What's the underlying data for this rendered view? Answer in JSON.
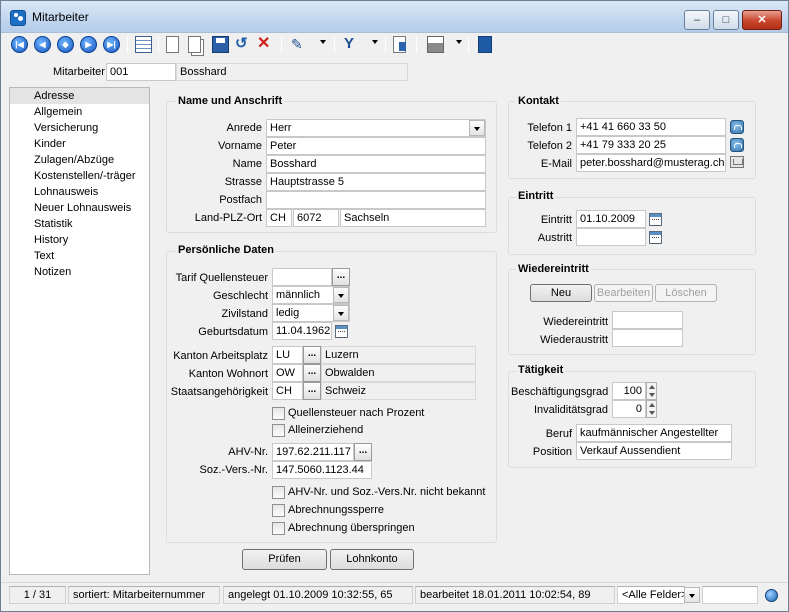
{
  "window": {
    "title": "Mitarbeiter",
    "minimize": "–",
    "maximize": "□",
    "close": "✕"
  },
  "header": {
    "label": "Mitarbeiter",
    "number": "001",
    "name": "Bosshard"
  },
  "sidebar": {
    "items": [
      "Adresse",
      "Allgemein",
      "Versicherung",
      "Kinder",
      "Zulagen/Abzüge",
      "Kostenstellen/-träger",
      "Lohnausweis",
      "Neuer Lohnausweis",
      "Statistik",
      "History",
      "Text",
      "Notizen"
    ]
  },
  "name_address": {
    "title": "Name und Anschrift",
    "anrede": {
      "label": "Anrede",
      "value": "Herr"
    },
    "vorname": {
      "label": "Vorname",
      "value": "Peter"
    },
    "name": {
      "label": "Name",
      "value": "Bosshard"
    },
    "strasse": {
      "label": "Strasse",
      "value": "Hauptstrasse 5"
    },
    "postfach": {
      "label": "Postfach",
      "value": ""
    },
    "land_plz_ort": {
      "label": "Land-PLZ-Ort",
      "land": "CH",
      "plz": "6072",
      "ort": "Sachseln"
    }
  },
  "personal": {
    "title": "Persönliche Daten",
    "tarif": {
      "label": "Tarif Quellensteuer",
      "value": ""
    },
    "geschlecht": {
      "label": "Geschlecht",
      "value": "männlich"
    },
    "zivilstand": {
      "label": "Zivilstand",
      "value": "ledig"
    },
    "geburtsdatum": {
      "label": "Geburtsdatum",
      "value": "11.04.1962"
    },
    "kanton_arbeitsplatz": {
      "label": "Kanton Arbeitsplatz",
      "code": "LU",
      "name": "Luzern"
    },
    "kanton_wohnort": {
      "label": "Kanton Wohnort",
      "code": "OW",
      "name": "Obwalden"
    },
    "staat": {
      "label": "Staatsangehörigkeit",
      "code": "CH",
      "name": "Schweiz"
    },
    "check_quellensteuer": "Quellensteuer nach Prozent",
    "check_alleinerziehend": "Alleinerziehend",
    "ahv": {
      "label": "AHV-Nr.",
      "value": "197.62.211.117"
    },
    "sozvers": {
      "label": "Soz.-Vers.-Nr.",
      "value": "147.5060.1123.44"
    },
    "check_unbekannt": "AHV-Nr. und Soz.-Vers.Nr. nicht bekannt",
    "check_sperre": "Abrechnungssperre",
    "check_ueberspringen": "Abrechnung überspringen"
  },
  "buttons": {
    "pruefen": "Prüfen",
    "lohnkonto": "Lohnkonto"
  },
  "contact": {
    "title": "Kontakt",
    "tel1": {
      "label": "Telefon 1",
      "value": "+41 41 660 33 50"
    },
    "tel2": {
      "label": "Telefon 2",
      "value": "+41 79 333 20 25"
    },
    "email": {
      "label": "E-Mail",
      "value": "peter.bosshard@musterag.ch"
    }
  },
  "entry": {
    "title": "Eintritt",
    "eintritt": {
      "label": "Eintritt",
      "value": "01.10.2009"
    },
    "austritt": {
      "label": "Austritt",
      "value": ""
    }
  },
  "reentry": {
    "title": "Wiedereintritt",
    "neu": "Neu",
    "bearbeiten": "Bearbeiten",
    "loeschen": "Löschen",
    "wiedereintritt_label": "Wiedereintritt",
    "wiederaustritt_label": "Wiederaustritt"
  },
  "activity": {
    "title": "Tätigkeit",
    "beschaeftigung": {
      "label": "Beschäftigungsgrad",
      "value": "100"
    },
    "invaliditaet": {
      "label": "Invaliditätsgrad",
      "value": "0"
    },
    "beruf": {
      "label": "Beruf",
      "value": "kaufmännischer Angestellter"
    },
    "position": {
      "label": "Position",
      "value": "Verkauf Aussendient"
    }
  },
  "status": {
    "record": "1 / 31",
    "sort": "sortiert: Mitarbeiternummer",
    "created": "angelegt 01.10.2009 10:32:55, 65",
    "edited": "bearbeitet 18.01.2011 10:02:54, 89",
    "filter": "<Alle Felder>"
  }
}
